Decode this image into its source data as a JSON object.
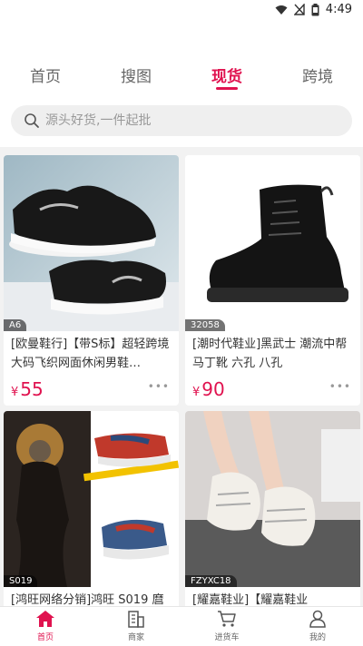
{
  "status_bar": {
    "time": "4:49"
  },
  "tabs": [
    {
      "label": "首页"
    },
    {
      "label": "搜图"
    },
    {
      "label": "现货"
    },
    {
      "label": "跨境"
    }
  ],
  "search": {
    "placeholder": "源头好货,一件起批"
  },
  "products": [
    {
      "code": "A6",
      "title": "[欧曼鞋行]【带S标】超轻跨境大码飞织网面休闲男鞋…",
      "price_symbol": "¥",
      "price": "55"
    },
    {
      "code": "32058",
      "title": "[潮时代鞋业]黑武士 潮流中帮马丁靴 六孔 八孔",
      "price_symbol": "¥",
      "price": "90"
    },
    {
      "code": "S019",
      "title": "[鸿旺网络分销]鸿旺 S019 麿",
      "price_symbol": "¥",
      "price": ""
    },
    {
      "code": "FZYXC18",
      "title": "[耀嘉鞋业]【耀嘉鞋业",
      "price_symbol": "¥",
      "price": ""
    }
  ],
  "bottom_nav": [
    {
      "label": "首页",
      "icon": "home-icon"
    },
    {
      "label": "商家",
      "icon": "building-icon"
    },
    {
      "label": "进货车",
      "icon": "cart-icon"
    },
    {
      "label": "我的",
      "icon": "person-icon"
    }
  ],
  "colors": {
    "accent": "#e0124f",
    "feed_bg": "#f2f2f2",
    "search_bg": "#efefef"
  }
}
